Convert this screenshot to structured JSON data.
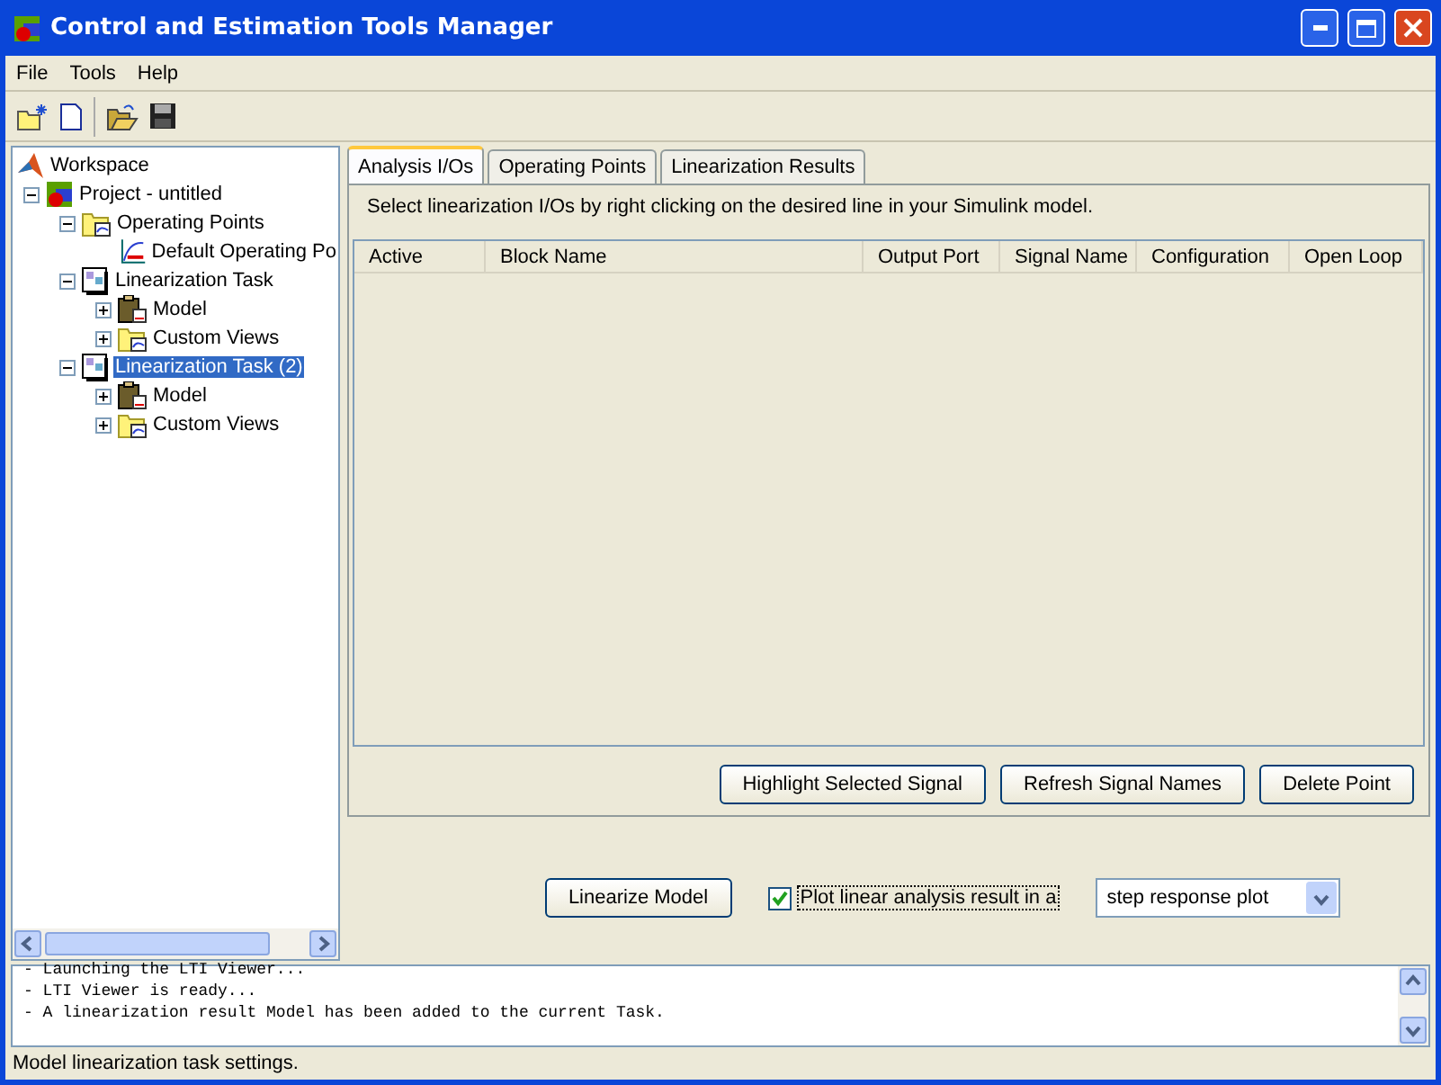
{
  "window": {
    "title": "Control and Estimation Tools Manager"
  },
  "menu": [
    "File",
    "Tools",
    "Help"
  ],
  "tree": [
    {
      "label": "Workspace",
      "kind": "workspace",
      "selected": false,
      "children": [
        {
          "label": "Project - untitled",
          "kind": "project",
          "selected": false,
          "expanded": true,
          "children": [
            {
              "label": "Operating Points",
              "kind": "folder",
              "selected": false,
              "expanded": true,
              "children": [
                {
                  "label": "Default Operating Po",
                  "kind": "plot",
                  "selected": false
                }
              ]
            },
            {
              "label": "Linearization Task",
              "kind": "task",
              "selected": false,
              "expanded": true,
              "children": [
                {
                  "label": "Model",
                  "kind": "model",
                  "selected": false,
                  "expanded": false
                },
                {
                  "label": "Custom Views",
                  "kind": "folder",
                  "selected": false,
                  "expanded": false
                }
              ]
            },
            {
              "label": "Linearization Task (2)",
              "kind": "task",
              "selected": true,
              "expanded": true,
              "children": [
                {
                  "label": "Model",
                  "kind": "model",
                  "selected": false,
                  "expanded": false
                },
                {
                  "label": "Custom Views",
                  "kind": "folder",
                  "selected": false,
                  "expanded": false
                }
              ]
            }
          ]
        }
      ]
    }
  ],
  "tabs": [
    {
      "label": "Analysis I/Os",
      "selected": true
    },
    {
      "label": "Operating Points",
      "selected": false
    },
    {
      "label": "Linearization Results",
      "selected": false
    }
  ],
  "instructions": "Select linearization I/Os by right clicking on the desired line in your Simulink model.",
  "table": {
    "columns": [
      "Active",
      "Block Name",
      "Output Port",
      "Signal Name",
      "Configuration",
      "Open Loop"
    ]
  },
  "table_buttons": [
    "Highlight Selected Signal",
    "Refresh Signal Names",
    "Delete Point"
  ],
  "linearize_button": "Linearize Model",
  "plot_option": {
    "label": "Plot linear analysis result in a",
    "checked": true
  },
  "plot_type": {
    "value": "step response plot"
  },
  "log": [
    "- Launching the LTI Viewer...",
    "- LTI Viewer is ready...",
    "- A linearization result Model has been added to the current Task."
  ],
  "status_bar": "Model linearization task settings."
}
